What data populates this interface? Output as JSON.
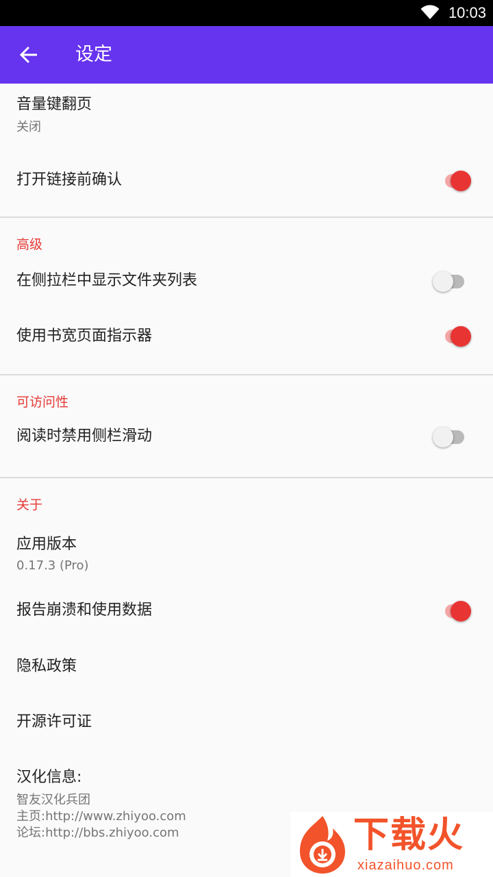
{
  "status_bar": {
    "time": "10:03",
    "wifi_icon": "wifi-icon"
  },
  "app_bar": {
    "title": "设定",
    "back_icon": "arrow-back-icon"
  },
  "colors": {
    "primary": "#6633ee",
    "accent": "#e53935",
    "toggle_on": "#e93434"
  },
  "sections": {
    "general": {
      "volume_page_turn": {
        "title": "音量键翻页",
        "summary": "关闭"
      },
      "confirm_links": {
        "title": "打开链接前确认",
        "enabled": true
      }
    },
    "advanced": {
      "header": "高级",
      "folder_list": {
        "title": "在侧拉栏中显示文件夹列表",
        "enabled": false
      },
      "page_indicator": {
        "title": "使用书宽页面指示器",
        "enabled": true
      }
    },
    "accessibility": {
      "header": "可访问性",
      "disable_sidebar_swipe": {
        "title": "阅读时禁用侧栏滑动",
        "enabled": false
      }
    },
    "about": {
      "header": "关于",
      "app_version": {
        "title": "应用版本",
        "summary": "0.17.3 (Pro)"
      },
      "crash_reports": {
        "title": "报告崩溃和使用数据",
        "enabled": true
      },
      "privacy_policy": {
        "title": "隐私政策"
      },
      "open_source": {
        "title": "开源许可证"
      },
      "localization": {
        "title": "汉化信息:",
        "lines": [
          "智友汉化兵团",
          "主页:http://www.zhiyoo.com",
          "论坛:http://bbs.zhiyoo.com"
        ]
      }
    }
  },
  "watermark": {
    "brand": "下载火",
    "site": "xiazaihuo.com"
  }
}
